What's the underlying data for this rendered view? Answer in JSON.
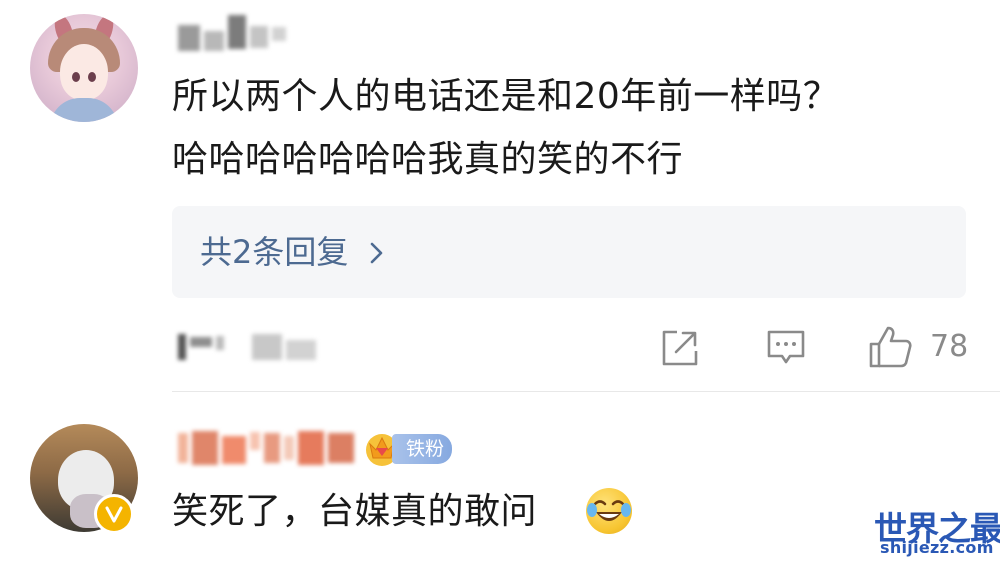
{
  "comment1": {
    "text_line1": "所以两个人的电话还是和20年前一样吗？",
    "text_line2": "哈哈哈哈哈哈哈我真的笑的不行",
    "replies_label": "共2条回复",
    "reply_chevron": "›",
    "icons": [
      "share-icon",
      "comment-icon",
      "like-icon"
    ],
    "like_count": "78"
  },
  "comment2": {
    "fan_badge_label": "铁粉",
    "text": "笑死了，台媒真的敢问",
    "emoji": "laughing-tears-emoji",
    "verified_icon": "v-badge-icon"
  },
  "watermark": {
    "main": "世界之最",
    "sub": "shijiezz.com"
  },
  "colors": {
    "link_blue": "#4d6a91",
    "reply_bg": "#f5f6f8",
    "icon_gray": "#8a8a8a",
    "watermark_blue": "#2a58b5"
  }
}
